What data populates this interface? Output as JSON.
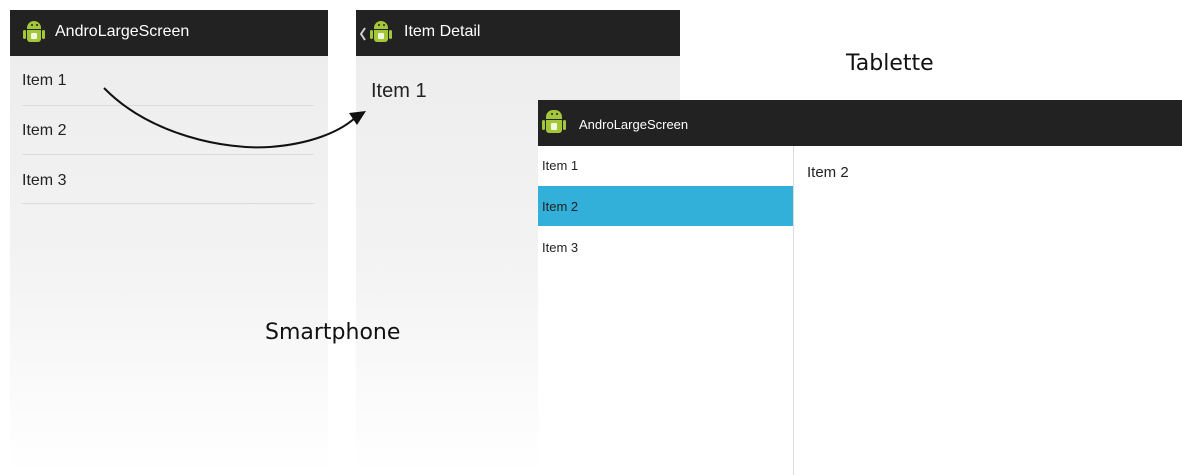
{
  "phone_list": {
    "app_title": "AndroLargeScreen",
    "items": [
      "Item 1",
      "Item 2",
      "Item 3"
    ]
  },
  "phone_detail": {
    "title": "Item Detail",
    "content": "Item 1"
  },
  "tablet": {
    "app_title": "AndroLargeScreen",
    "items": [
      "Item 1",
      "Item 2",
      "Item 3"
    ],
    "selected_item": "Item 2",
    "detail_content": "Item 2"
  },
  "labels": {
    "smartphone": "Smartphone",
    "tablet": "Tablette"
  },
  "colors": {
    "action_bar": "#222222",
    "android_green": "#a4c639",
    "selection": "#33b0d9",
    "screen_gradient_top": "#ececec",
    "screen_gradient_bottom": "#ffffff"
  },
  "icons": [
    "android-app-icon",
    "back-chevron-icon",
    "navigation-arrow"
  ]
}
